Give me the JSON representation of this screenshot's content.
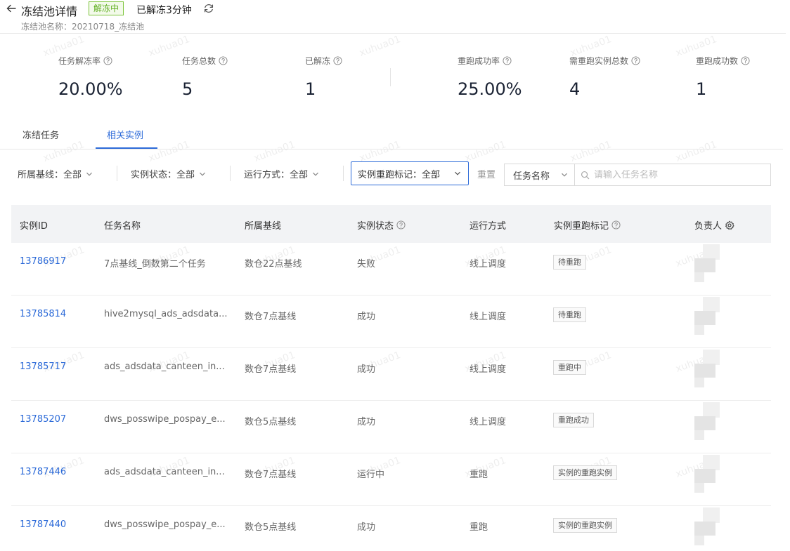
{
  "header": {
    "title": "冻结池详情",
    "status_badge": "解冻中",
    "elapsed": "已解冻3分钟",
    "pool_name": "冻结池名称：20210718_冻结池"
  },
  "stats": [
    {
      "label": "任务解冻率",
      "value": "20.00%"
    },
    {
      "label": "任务总数",
      "value": "5"
    },
    {
      "label": "已解冻",
      "value": "1"
    },
    {
      "label": "重跑成功率",
      "value": "25.00%"
    },
    {
      "label": "需重跑实例总数",
      "value": "4"
    },
    {
      "label": "重跑成功数",
      "value": "1"
    }
  ],
  "tabs": [
    {
      "label": "冻结任务"
    },
    {
      "label": "相关实例",
      "active": true
    }
  ],
  "filters": {
    "baseline": "所属基线：全部",
    "instance_status": "实例状态：全部",
    "run_mode": "运行方式：全部",
    "rerun_mark": "实例重跑标记：全部",
    "reset": "重置",
    "search_field": "任务名称",
    "search_placeholder": "请输入任务名称"
  },
  "table": {
    "columns": [
      "实例ID",
      "任务名称",
      "所属基线",
      "实例状态",
      "运行方式",
      "实例重跑标记",
      "负责人"
    ],
    "rows": [
      {
        "id": "13786917",
        "name": "7点基线_倒数第二个任务",
        "baseline": "数仓22点基线",
        "status": "失败",
        "mode": "线上调度",
        "mark": "待重跑"
      },
      {
        "id": "13785814",
        "name": "hive2mysql_ads_adsdata...",
        "baseline": "数仓7点基线",
        "status": "成功",
        "mode": "线上调度",
        "mark": "待重跑"
      },
      {
        "id": "13785717",
        "name": "ads_adsdata_canteen_in...",
        "baseline": "数仓7点基线",
        "status": "成功",
        "mode": "线上调度",
        "mark": "重跑中"
      },
      {
        "id": "13785207",
        "name": "dws_posswipe_pospay_e...",
        "baseline": "数仓5点基线",
        "status": "成功",
        "mode": "线上调度",
        "mark": "重跑成功"
      },
      {
        "id": "13787446",
        "name": "ads_adsdata_canteen_in...",
        "baseline": "数仓7点基线",
        "status": "运行中",
        "mode": "重跑",
        "mark": "实例的重跑实例"
      },
      {
        "id": "13787440",
        "name": "dws_posswipe_pospay_e...",
        "baseline": "数仓5点基线",
        "status": "成功",
        "mode": "重跑",
        "mark": "实例的重跑实例"
      }
    ]
  },
  "watermark": "xuhua01",
  "colors": {
    "primary": "#2c6ad8",
    "success_badge": "#5fae20"
  }
}
